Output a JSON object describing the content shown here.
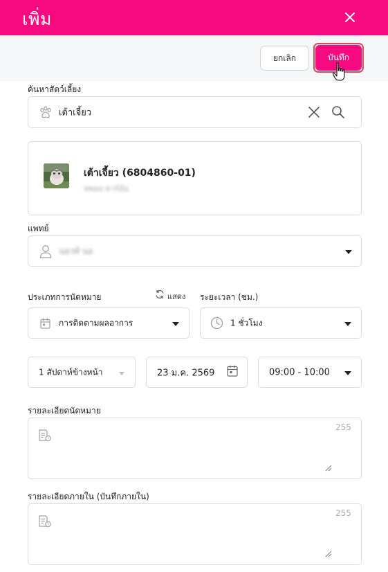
{
  "header": {
    "title": "เพิ่ม",
    "background": "#f7097f"
  },
  "actions": {
    "cancel_label": "ยกเลิก",
    "save_label": "บันทึก"
  },
  "pet_search": {
    "label": "ค้นหาสัตว์เลี้ยง",
    "value": "เต้าเจี้ยว"
  },
  "pet_card": {
    "name": "เต้าเจี้ยว (6804860-01)",
    "owner": "ทพลล ดาร์อัน"
  },
  "doctor": {
    "label": "แพทย์",
    "value": "นอวท์ นอ"
  },
  "appointment_type": {
    "label": "ประเภทการนัดหมาย",
    "show_label": "แสดง",
    "value": "การติดตามผลอาการ"
  },
  "duration": {
    "label": "ระยะเวลา (ชม.)",
    "value": "1 ชั่วโมง"
  },
  "date_row": {
    "relative": "1 สัปดาห์ข้างหน้า",
    "date": "23 ม.ค. 2569",
    "time": "09:00 - 10:00"
  },
  "appointment_detail": {
    "label": "รายละเอียดนัดหมาย",
    "counter": "255"
  },
  "internal_detail": {
    "label": "รายละเอียดภายใน (บันทึกภายใน)",
    "counter": "255"
  },
  "icons": [
    "close-icon",
    "paw-icon",
    "clear-icon",
    "search-icon",
    "user-icon",
    "refresh-icon",
    "calendar-icon",
    "clock-icon",
    "note-icon",
    "chevron-down-icon",
    "hand-cursor-icon"
  ]
}
